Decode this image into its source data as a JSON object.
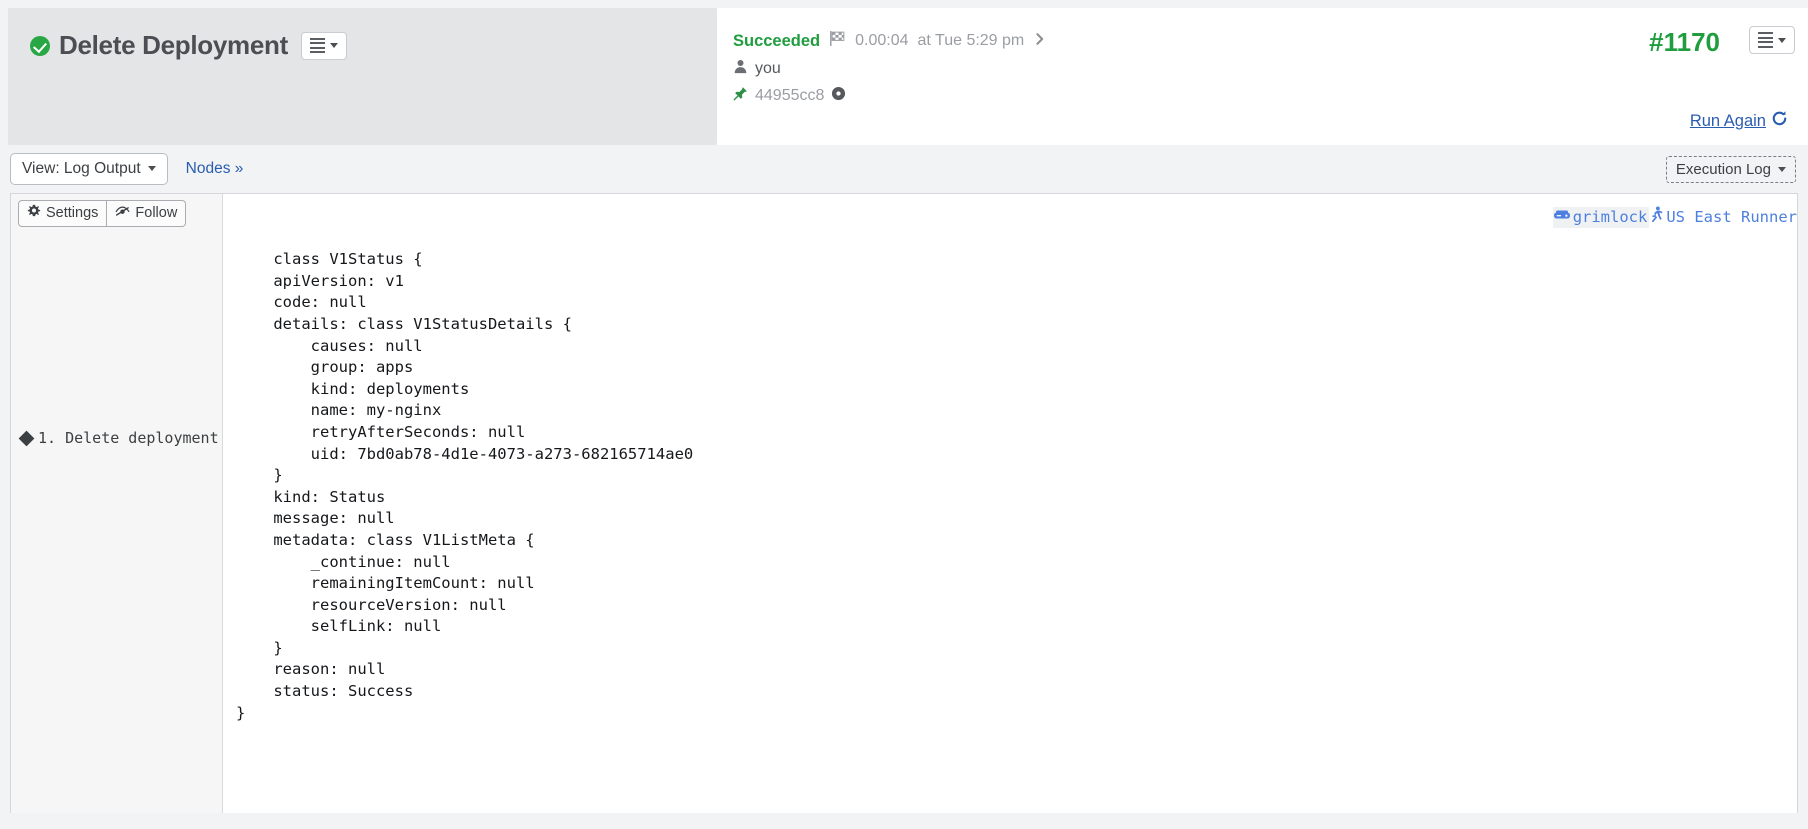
{
  "header": {
    "status_icon": "green-check-circle-icon",
    "title": "Delete Deployment",
    "menu_icon": "list-menu-icon",
    "status": {
      "state": "Succeeded",
      "duration_icon": "checkered-flag-icon",
      "duration": "0.00:04",
      "timestamp": "at Tue 5:29 pm",
      "chevron_icon": "chevron-right-icon",
      "user_icon": "person-icon",
      "user": "you",
      "commit_icon": "pin-icon",
      "commit": "44955cc8",
      "commit_status_icon": "clock-icon"
    },
    "build_number": "#1170",
    "build_menu_icon": "list-menu-icon",
    "run_again": "Run Again",
    "run_again_icon": "refresh-icon"
  },
  "toolbar": {
    "view_label": "View: Log Output",
    "nodes_label": "Nodes »",
    "execution_log_label": "Execution Log"
  },
  "log": {
    "settings_label": "Settings",
    "settings_icon": "gear-icon",
    "follow_label": "Follow",
    "follow_icon": "eye-slash-icon",
    "steps": [
      {
        "marker_icon": "diamond-icon",
        "label": "1. Delete deployment"
      }
    ],
    "nodes": [
      {
        "icon": "server-icon",
        "label": "grimlock"
      },
      {
        "icon": "runner-icon",
        "label": "US East Runner"
      }
    ],
    "output": "class V1Status {\n    apiVersion: v1\n    code: null\n    details: class V1StatusDetails {\n        causes: null\n        group: apps\n        kind: deployments\n        name: my-nginx\n        retryAfterSeconds: null\n        uid: 7bd0ab78-4d1e-4073-a273-682165714ae0\n    }\n    kind: Status\n    message: null\n    metadata: class V1ListMeta {\n        _continue: null\n        remainingItemCount: null\n        resourceVersion: null\n        selfLink: null\n    }\n    reason: null\n    status: Success\n}"
  },
  "colors": {
    "success_green": "#1f9d3f",
    "link_blue": "#2a5db0",
    "node_blue": "#4d7fe0",
    "panel_grey": "#e4e5e7",
    "page_bg": "#f2f3f4"
  }
}
